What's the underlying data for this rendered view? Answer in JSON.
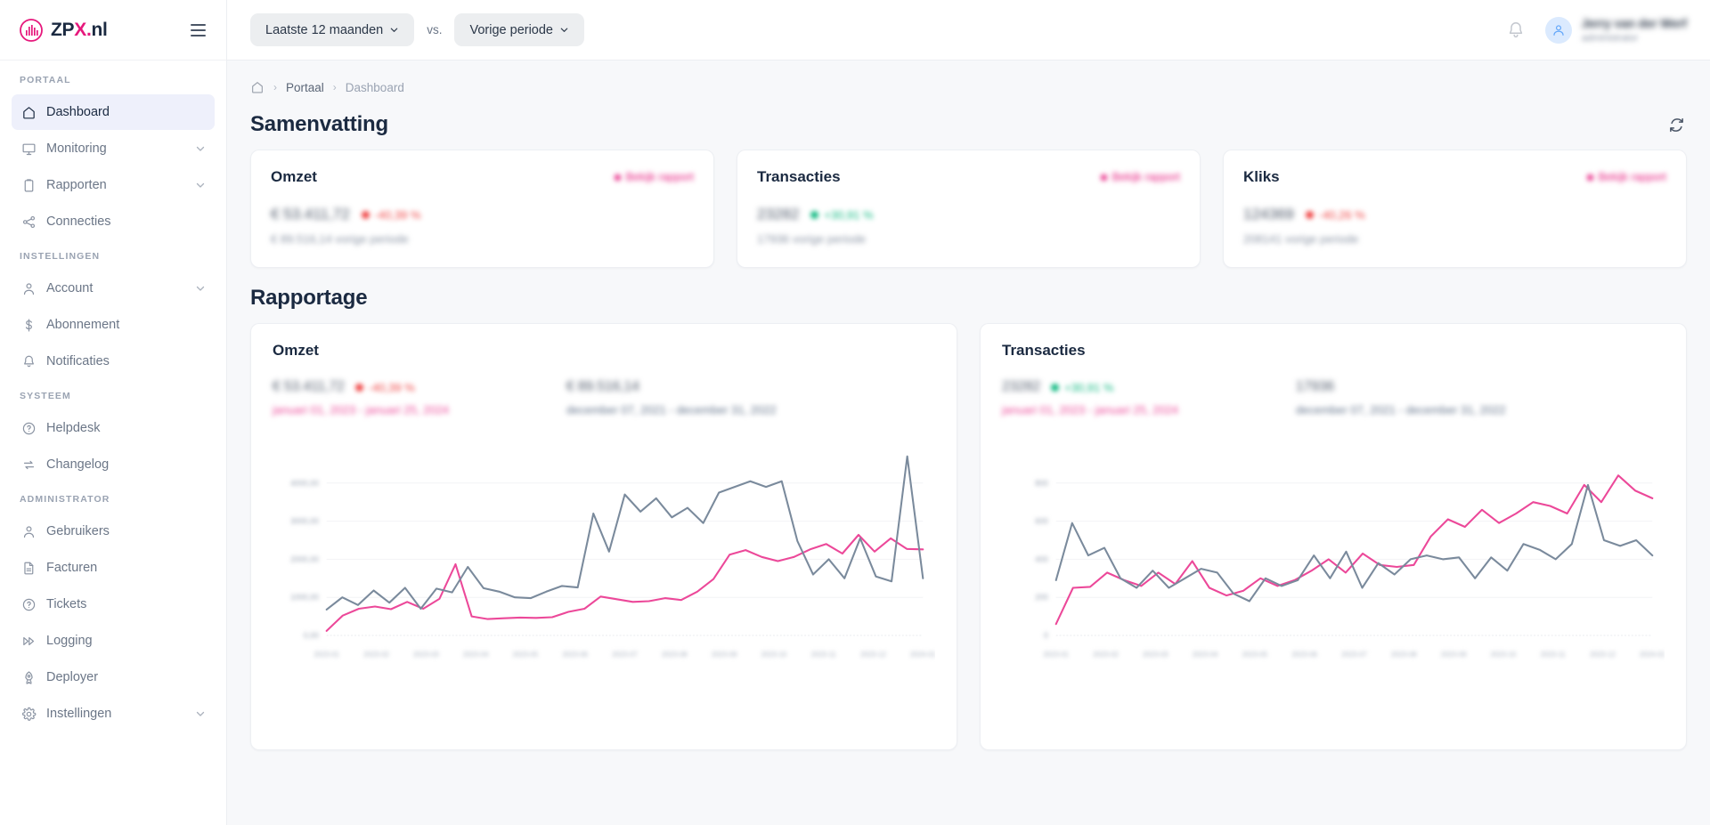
{
  "brand": {
    "name_dark": "ZP",
    "name_accent": "X",
    "name_tail": "nl",
    "dot": "."
  },
  "topbar": {
    "period_button": "Laatste 12 maanden",
    "vs_label": "vs.",
    "compare_button": "Vorige periode",
    "user_name": "Jerry van der Werf",
    "user_sub": "administrator"
  },
  "sidebar": {
    "sections": [
      {
        "label": "PORTAAL",
        "items": [
          {
            "label": "Dashboard",
            "icon": "home-icon",
            "active": true,
            "chevron": false
          },
          {
            "label": "Monitoring",
            "icon": "monitor-icon",
            "active": false,
            "chevron": true
          },
          {
            "label": "Rapporten",
            "icon": "clipboard-icon",
            "active": false,
            "chevron": true
          },
          {
            "label": "Connecties",
            "icon": "share-icon",
            "active": false,
            "chevron": false
          }
        ]
      },
      {
        "label": "INSTELLINGEN",
        "items": [
          {
            "label": "Account",
            "icon": "user-icon",
            "active": false,
            "chevron": true
          },
          {
            "label": "Abonnement",
            "icon": "dollar-icon",
            "active": false,
            "chevron": false
          },
          {
            "label": "Notificaties",
            "icon": "bell-icon",
            "active": false,
            "chevron": false
          }
        ]
      },
      {
        "label": "SYSTEEM",
        "items": [
          {
            "label": "Helpdesk",
            "icon": "question-circle-icon",
            "active": false,
            "chevron": false
          },
          {
            "label": "Changelog",
            "icon": "swap-icon",
            "active": false,
            "chevron": false
          }
        ]
      },
      {
        "label": "ADMINISTRATOR",
        "items": [
          {
            "label": "Gebruikers",
            "icon": "user-icon",
            "active": false,
            "chevron": false
          },
          {
            "label": "Facturen",
            "icon": "document-icon",
            "active": false,
            "chevron": false
          },
          {
            "label": "Tickets",
            "icon": "question-circle-icon",
            "active": false,
            "chevron": false
          },
          {
            "label": "Logging",
            "icon": "forward-icon",
            "active": false,
            "chevron": false
          },
          {
            "label": "Deployer",
            "icon": "rocket-icon",
            "active": false,
            "chevron": false
          },
          {
            "label": "Instellingen",
            "icon": "gear-icon",
            "active": false,
            "chevron": true
          }
        ]
      }
    ]
  },
  "breadcrumb": {
    "home": "home-icon",
    "items": [
      "Portaal",
      "Dashboard"
    ],
    "separator": "›"
  },
  "summary": {
    "title": "Samenvatting",
    "refresh_icon": "refresh-icon",
    "cards": [
      {
        "title": "Omzet",
        "link": "Bekijk rapport",
        "value": "€ 53.411,72",
        "delta": "-40,39 %",
        "delta_dir": "down",
        "previous": "€ 89.516,14 vorige periode"
      },
      {
        "title": "Transacties",
        "link": "Bekijk rapport",
        "value": "23282",
        "delta": "+30,91 %",
        "delta_dir": "up",
        "previous": "17936 vorige periode"
      },
      {
        "title": "Kliks",
        "link": "Bekijk rapport",
        "value": "124369",
        "delta": "-40,26 %",
        "delta_dir": "down",
        "previous": "208141 vorige periode"
      }
    ]
  },
  "reporting": {
    "title": "Rapportage",
    "panels": [
      {
        "title": "Omzet",
        "current": {
          "value": "€ 53.411,72",
          "delta": "-40,39 %",
          "delta_dir": "down",
          "range": "januari 01, 2023 - januari 25, 2024"
        },
        "previous": {
          "value": "€ 89.516,14",
          "range": "december 07, 2021 - december 31, 2022"
        }
      },
      {
        "title": "Transacties",
        "current": {
          "value": "23282",
          "delta": "+30,91 %",
          "delta_dir": "up",
          "range": "januari 01, 2023 - januari 25, 2024"
        },
        "previous": {
          "value": "17936",
          "range": "december 07, 2021 - december 31, 2022"
        }
      }
    ]
  },
  "colors": {
    "accent_pink": "#e6187c",
    "series_current": "#ec4899",
    "series_previous": "#7a8a9c",
    "positive": "#10b981",
    "negative": "#ef4444",
    "navy": "#1b2a41",
    "page_bg": "#f7f8fa"
  },
  "chart_data": [
    {
      "type": "line",
      "title": "Omzet",
      "xlabel": "",
      "ylabel": "",
      "grid": true,
      "legend_position": "top",
      "ylim": [
        0,
        5000
      ],
      "yticks": [
        0,
        1000,
        2000,
        3000,
        4000
      ],
      "ytick_labels": [
        "0,00",
        "1000,00",
        "2000,00",
        "3000,00",
        "4000,00"
      ],
      "x": [
        "2023-01",
        "2023-02",
        "2023-03",
        "2023-04",
        "2023-05",
        "2023-06",
        "2023-07",
        "2023-08",
        "2023-09",
        "2023-10",
        "2023-11",
        "2023-12",
        "2024-01"
      ],
      "series": [
        {
          "name": "januari 01, 2023 - januari 25, 2024",
          "color": "#ec4899",
          "values": [
            120,
            520,
            700,
            760,
            690,
            880,
            700,
            960,
            1870,
            500,
            430,
            450,
            470,
            460,
            480,
            620,
            700,
            1020,
            950,
            880,
            900,
            980,
            930,
            1150,
            1480,
            2120,
            2240,
            2060,
            1950,
            2060,
            2260,
            2400,
            2150,
            2640,
            2200,
            2550,
            2270,
            2260
          ]
        },
        {
          "name": "december 07, 2021 - december 31, 2022",
          "color": "#7a8a9c",
          "values": [
            680,
            1000,
            800,
            1180,
            860,
            1250,
            700,
            1230,
            1130,
            1800,
            1240,
            1150,
            1000,
            980,
            1150,
            1300,
            1260,
            3200,
            2200,
            3700,
            3250,
            3600,
            3100,
            3350,
            2950,
            3750,
            3900,
            4050,
            3900,
            4050,
            2480,
            1600,
            2000,
            1500,
            2550,
            1550,
            1420,
            4700,
            1500
          ]
        }
      ]
    },
    {
      "type": "line",
      "title": "Transacties",
      "xlabel": "",
      "ylabel": "",
      "grid": true,
      "legend_position": "top",
      "ylim": [
        0,
        1000
      ],
      "yticks": [
        0,
        200,
        400,
        600,
        800
      ],
      "ytick_labels": [
        "0",
        "200",
        "400",
        "600",
        "800"
      ],
      "x": [
        "2023-01",
        "2023-02",
        "2023-03",
        "2023-04",
        "2023-05",
        "2023-06",
        "2023-07",
        "2023-08",
        "2023-09",
        "2023-10",
        "2023-11",
        "2023-12",
        "2024-01"
      ],
      "series": [
        {
          "name": "januari 01, 2023 - januari 25, 2024",
          "color": "#ec4899",
          "values": [
            60,
            250,
            255,
            330,
            290,
            260,
            330,
            270,
            390,
            250,
            210,
            235,
            300,
            260,
            290,
            340,
            400,
            330,
            430,
            370,
            360,
            370,
            520,
            610,
            570,
            660,
            590,
            640,
            700,
            680,
            640,
            790,
            700,
            840,
            760,
            720
          ]
        },
        {
          "name": "december 07, 2021 - december 31, 2022",
          "color": "#7a8a9c",
          "values": [
            290,
            590,
            420,
            460,
            300,
            250,
            340,
            250,
            300,
            350,
            330,
            220,
            180,
            300,
            260,
            290,
            420,
            300,
            440,
            250,
            380,
            320,
            400,
            420,
            400,
            410,
            300,
            410,
            340,
            480,
            450,
            400,
            480,
            790,
            500,
            470,
            500,
            420
          ]
        }
      ]
    }
  ]
}
